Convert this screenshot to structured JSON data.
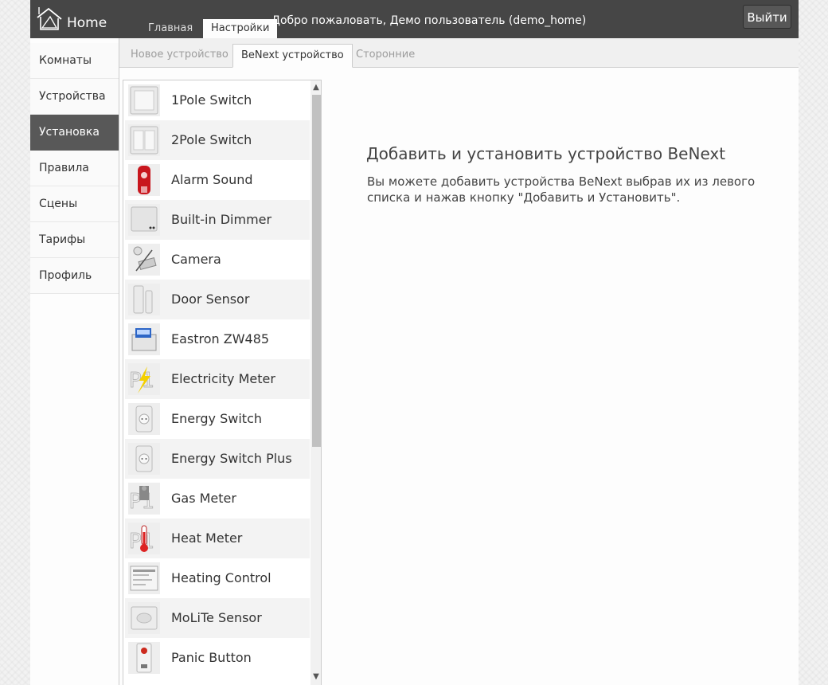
{
  "header": {
    "app_title": "Home",
    "tabs": [
      {
        "label": "Главная",
        "active": false
      },
      {
        "label": "Настройки",
        "active": true
      }
    ],
    "welcome": "Добро пожаловать, Демо пользователь (demo_home)",
    "logout_label": "Выйти"
  },
  "sidebar": {
    "items": [
      {
        "label": "Комнаты",
        "active": false
      },
      {
        "label": "Устройства",
        "active": false
      },
      {
        "label": "Установка",
        "active": true
      },
      {
        "label": "Правила",
        "active": false
      },
      {
        "label": "Сцены",
        "active": false
      },
      {
        "label": "Тарифы",
        "active": false
      },
      {
        "label": "Профиль",
        "active": false
      }
    ]
  },
  "subtabs": [
    {
      "label": "Новое устройство",
      "active": false
    },
    {
      "label": "BeNext устройство",
      "active": true
    },
    {
      "label": "Сторонние",
      "active": false
    }
  ],
  "devices": [
    {
      "name": "1Pole Switch",
      "icon": "wall-switch-single"
    },
    {
      "name": "2Pole Switch",
      "icon": "wall-switch-double"
    },
    {
      "name": "Alarm Sound",
      "icon": "siren"
    },
    {
      "name": "Built-in Dimmer",
      "icon": "dimmer-module"
    },
    {
      "name": "Camera",
      "icon": "camera"
    },
    {
      "name": "Door Sensor",
      "icon": "door-sensor"
    },
    {
      "name": "Eastron ZW485",
      "icon": "power-meter"
    },
    {
      "name": "Electricity Meter",
      "icon": "p1-electricity"
    },
    {
      "name": "Energy Switch",
      "icon": "plug"
    },
    {
      "name": "Energy Switch Plus",
      "icon": "plug"
    },
    {
      "name": "Gas Meter",
      "icon": "p1-gas"
    },
    {
      "name": "Heat Meter",
      "icon": "p1-heat"
    },
    {
      "name": "Heating Control",
      "icon": "heating-control"
    },
    {
      "name": "MoLiTe Sensor",
      "icon": "motion-sensor"
    },
    {
      "name": "Panic Button",
      "icon": "panic-button"
    }
  ],
  "info": {
    "title": "Добавить и установить устройство BeNext",
    "text": "Вы можете добавить устройства BeNext выбрав их из левого списка и нажав кнопку \"Добавить и Установить\"."
  },
  "colors": {
    "header_bg": "#464646",
    "active_sidebar_bg": "#585858",
    "page_bg": "#fdfdfd"
  }
}
